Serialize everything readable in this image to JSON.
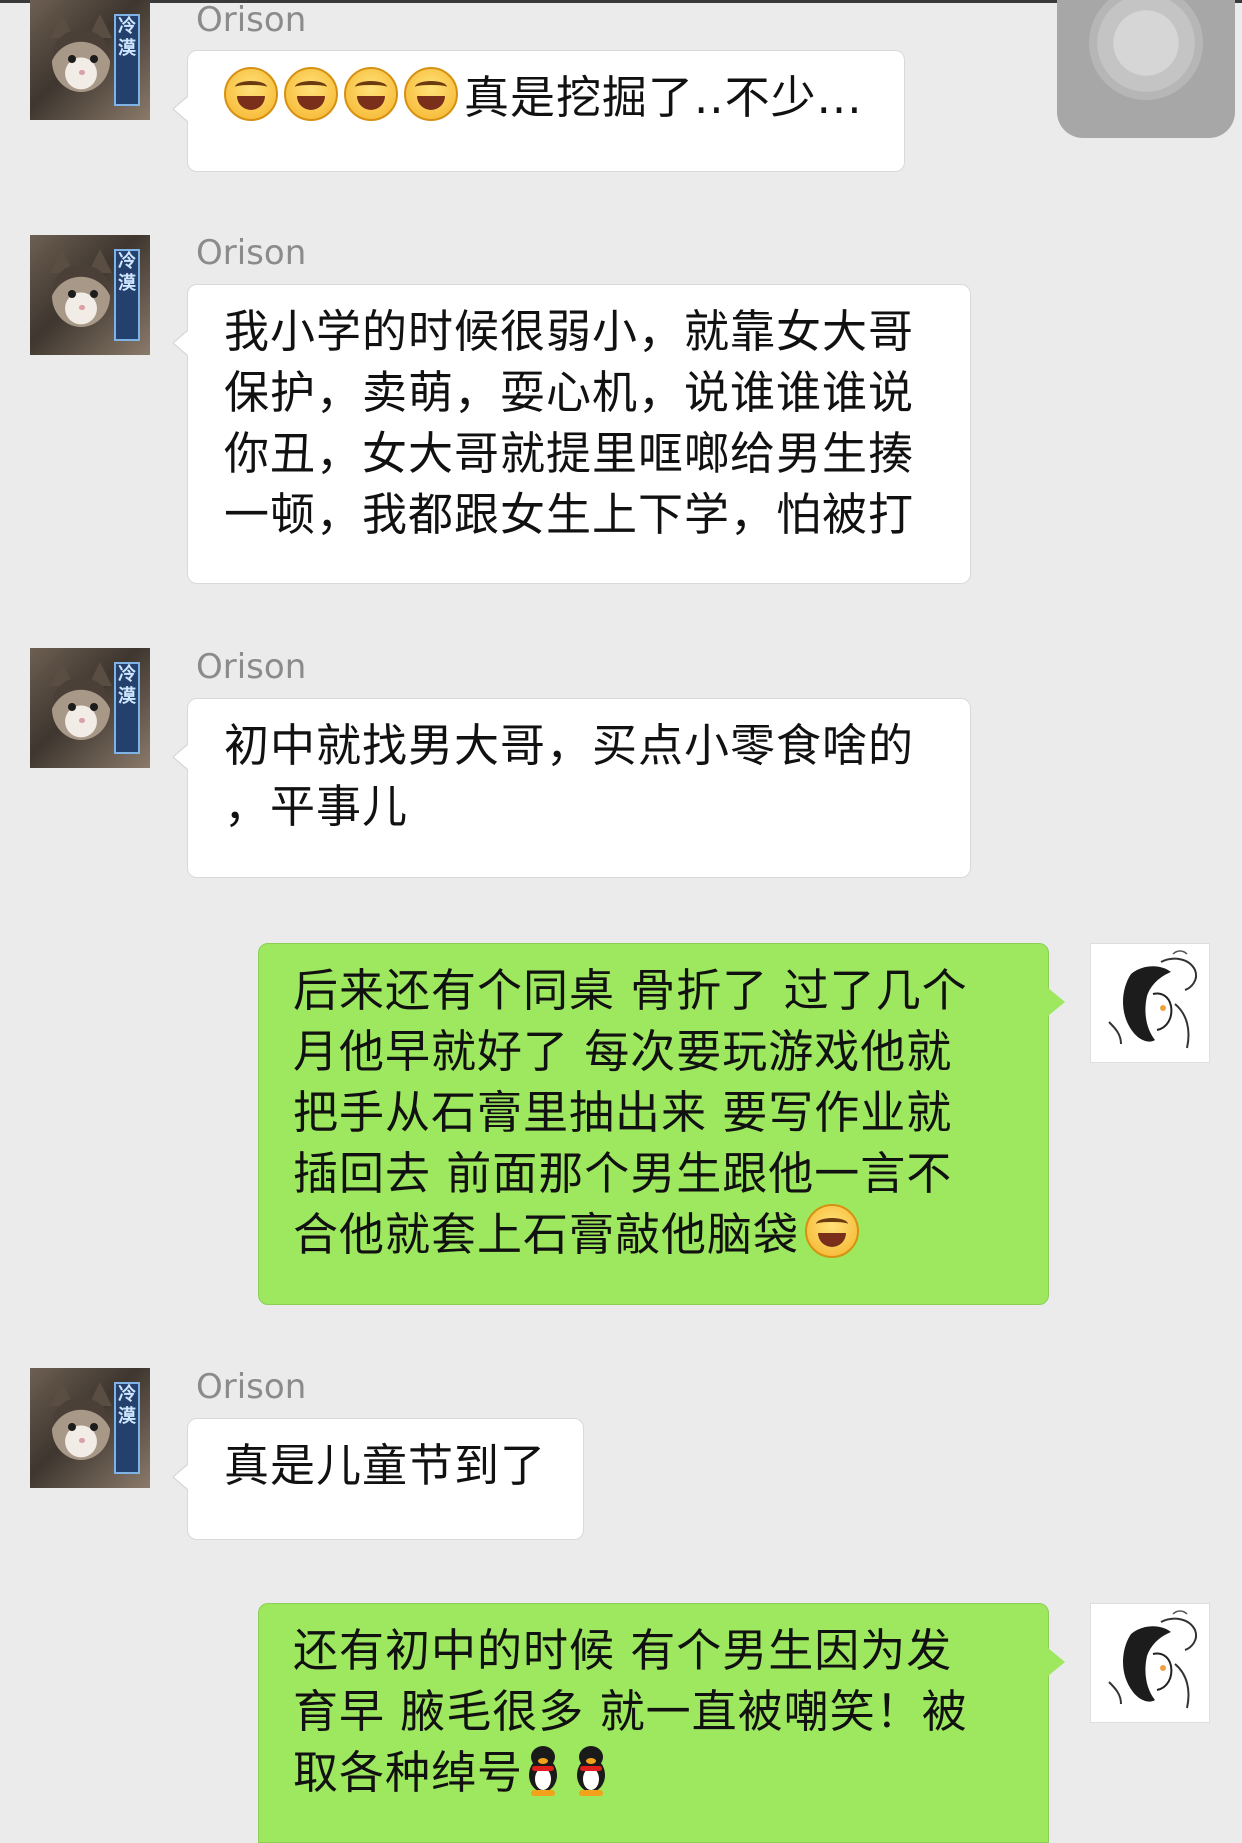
{
  "messages": [
    {
      "side": "left",
      "sender": "Orison",
      "text": "真是挖掘了..不少...",
      "emoji_prefix": [
        "tears-of-joy",
        "tears-of-joy",
        "tears-of-joy",
        "tears-of-joy"
      ]
    },
    {
      "side": "left",
      "sender": "Orison",
      "lines": [
        "我小学的时候很弱小，就靠女大哥",
        "保护，卖萌，耍心机，说谁谁谁说",
        "你丑，女大哥就提里哐啷给男生揍",
        "一顿，我都跟女生上下学，怕被打"
      ]
    },
    {
      "side": "left",
      "sender": "Orison",
      "lines": [
        "初中就找男大哥，买点小零食啥的",
        "，平事儿"
      ]
    },
    {
      "side": "right",
      "lines": [
        "后来还有个同桌 骨折了 过了几个",
        "月他早就好了 每次要玩游戏他就",
        "把手从石膏里抽出来 要写作业就",
        "插回去 前面那个男生跟他一言不",
        "合他就套上石膏敲他脑袋"
      ],
      "emoji_suffix": "tears-of-joy"
    },
    {
      "side": "left",
      "sender": "Orison",
      "text": "真是儿童节到了"
    },
    {
      "side": "right",
      "lines": [
        "还有初中的时候 有个男生因为发",
        "育早 腋毛很多 就一直被嘲笑！被",
        "取各种绰号"
      ],
      "emoji_suffix_qq": [
        "qq-penguin",
        "qq-penguin"
      ]
    }
  ],
  "avatar_left_tag": "冷漠",
  "colors": {
    "background": "#ebebeb",
    "self_bubble": "#9ee85f",
    "other_bubble": "#ffffff",
    "sender_name": "#8b8b8b"
  }
}
